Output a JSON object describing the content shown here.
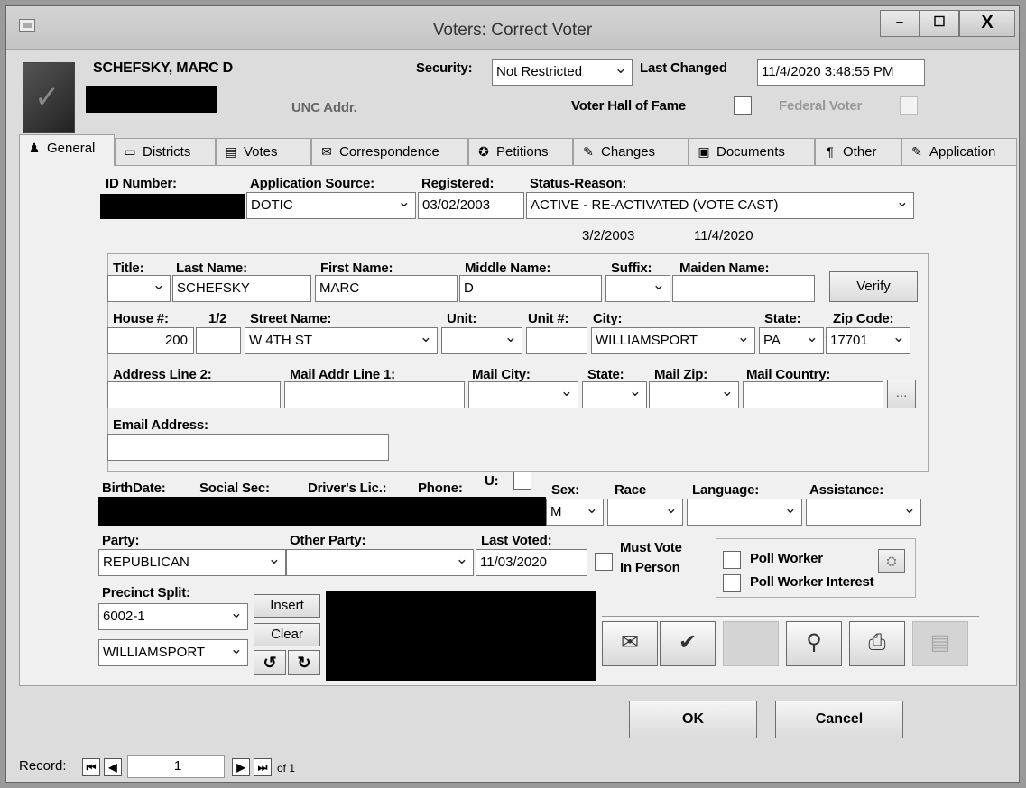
{
  "window": {
    "title": "Voters: Correct Voter",
    "min": "–",
    "max": "☐",
    "close": "X"
  },
  "header": {
    "voter_name": "SCHEFSKY, MARC D",
    "unc_addr_label": "UNC Addr.",
    "security_label": "Security:",
    "security_value": "Not Restricted",
    "last_changed_label": "Last Changed",
    "last_changed_value": "11/4/2020 3:48:55 PM",
    "hall_of_fame_label": "Voter Hall of Fame",
    "federal_voter_label": "Federal Voter"
  },
  "tabs": [
    {
      "label": "General",
      "icon": "person-icon"
    },
    {
      "label": "Districts",
      "icon": "districts-icon"
    },
    {
      "label": "Votes",
      "icon": "votes-icon"
    },
    {
      "label": "Correspondence",
      "icon": "mail-icon"
    },
    {
      "label": "Petitions",
      "icon": "petition-icon"
    },
    {
      "label": "Changes",
      "icon": "edit-icon"
    },
    {
      "label": "Documents",
      "icon": "documents-icon"
    },
    {
      "label": "Other",
      "icon": "other-icon"
    },
    {
      "label": "Application",
      "icon": "application-icon"
    }
  ],
  "general": {
    "id_number_label": "ID Number:",
    "app_source_label": "Application Source:",
    "app_source_value": "DOTIC",
    "registered_label": "Registered:",
    "registered_value": "03/02/2003",
    "status_label": "Status-Reason:",
    "status_value": "ACTIVE - RE-ACTIVATED (VOTE CAST)",
    "date_1": "3/2/2003",
    "date_2": "11/4/2020"
  },
  "name": {
    "title_label": "Title:",
    "title_value": "",
    "last_label": "Last Name:",
    "last_value": "SCHEFSKY",
    "first_label": "First Name:",
    "first_value": "MARC",
    "middle_label": "Middle Name:",
    "middle_value": "D",
    "suffix_label": "Suffix:",
    "suffix_value": "",
    "maiden_label": "Maiden Name:",
    "maiden_value": "",
    "verify_label": "Verify"
  },
  "address": {
    "house_label": "House #:",
    "house_value": "200",
    "half_label": "1/2",
    "half_value": "",
    "street_label": "Street Name:",
    "street_value": "W 4TH ST",
    "unit_label": "Unit:",
    "unit_value": "",
    "unit_num_label": "Unit #:",
    "unit_num_value": "",
    "city_label": "City:",
    "city_value": "WILLIAMSPORT",
    "state_label": "State:",
    "state_value": "PA",
    "zip_label": "Zip Code:",
    "zip_value": "17701",
    "addr2_label": "Address Line 2:",
    "mail1_label": "Mail Addr Line 1:",
    "mail_city_label": "Mail City:",
    "mail_state_label": "State:",
    "mail_zip_label": "Mail Zip:",
    "mail_country_label": "Mail Country:",
    "ellipsis": "...",
    "email_label": "Email Address:"
  },
  "personal": {
    "birthdate_label": "BirthDate:",
    "ssn_label": "Social Sec:",
    "dl_label": "Driver's Lic.:",
    "phone_label": "Phone:",
    "u_label": "U:",
    "sex_label": "Sex:",
    "sex_value": "M",
    "race_label": "Race",
    "language_label": "Language:",
    "assistance_label": "Assistance:"
  },
  "party": {
    "party_label": "Party:",
    "party_value": "REPUBLICAN",
    "other_label": "Other Party:",
    "other_value": "",
    "last_voted_label": "Last Voted:",
    "last_voted_value": "11/03/2020",
    "must_vote_label_1": "Must Vote",
    "must_vote_label_2": "In Person",
    "poll_worker_label": "Poll Worker",
    "poll_interest_label": "Poll Worker Interest"
  },
  "precinct": {
    "label": "Precinct Split:",
    "split_value": "6002-1",
    "municipality_value": "WILLIAMSPORT",
    "insert_label": "Insert",
    "clear_label": "Clear",
    "undo_icon": "↺",
    "redo_icon": "↻"
  },
  "footer": {
    "ok_label": "OK",
    "cancel_label": "Cancel",
    "record_label": "Record:",
    "record_value": "1",
    "of_label": "of 1"
  }
}
